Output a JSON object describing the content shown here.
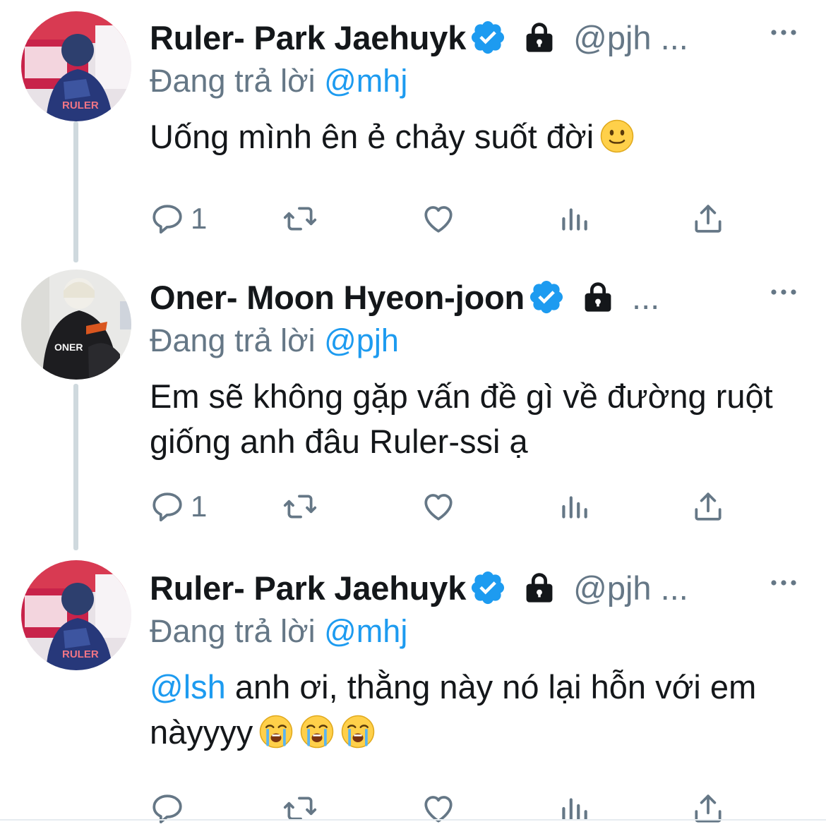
{
  "colors": {
    "accent": "#1d9bf0",
    "secondary_text": "#657786",
    "primary_text": "#14171a",
    "thread_line": "#cfd9de"
  },
  "tweets": [
    {
      "name": "Ruler- Park Jaehuyk",
      "verified_icon": "verified-badge-icon",
      "lock_icon": "lock-icon",
      "handle": "@pjh ...",
      "reply_prefix": "Đang trả lời",
      "reply_to": "@mhj",
      "text": "Uống mình ên ẻ chảy suốt đời",
      "emoji": [
        "slightly-smiling-face-emoji"
      ],
      "reply_count": "1"
    },
    {
      "name": "Oner- Moon Hyeon-joon",
      "verified_icon": "verified-badge-icon",
      "lock_icon": "lock-icon",
      "handle": "...",
      "reply_prefix": "Đang trả lời",
      "reply_to": "@pjh",
      "text": "Em sẽ không gặp vấn đề gì về đường ruột giống anh đâu Ruler-ssi ạ",
      "reply_count": "1",
      "avatar_jacket_text": "ONER"
    },
    {
      "name": "Ruler- Park Jaehuyk",
      "verified_icon": "verified-badge-icon",
      "lock_icon": "lock-icon",
      "handle": "@pjh ...",
      "reply_prefix": "Đang trả lời",
      "reply_to": "@mhj",
      "text_mention": "@lsh",
      "text": "anh ơi, thằng này nó lại hỗn với em nàyyyy",
      "emoji": [
        "loudly-crying-face-emoji",
        "loudly-crying-face-emoji",
        "loudly-crying-face-emoji"
      ],
      "reply_count": ""
    }
  ],
  "avatar_jersey_text": "RULER",
  "actions": {
    "reply_icon": "reply-icon",
    "retweet_icon": "retweet-icon",
    "like_icon": "heart-icon",
    "analytics_icon": "analytics-icon",
    "share_icon": "share-icon",
    "more_icon": "more-horizontal-icon"
  }
}
